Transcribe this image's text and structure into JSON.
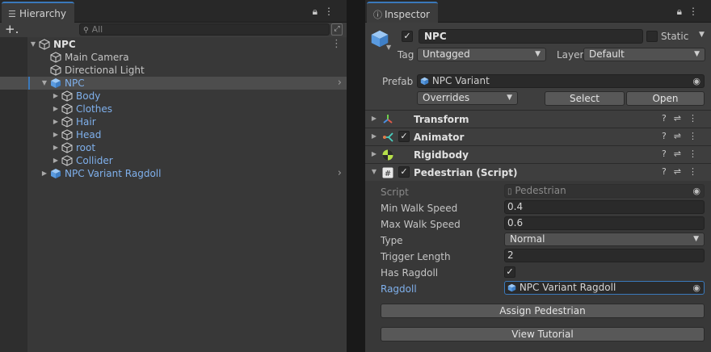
{
  "hierarchy": {
    "tab_label": "Hierarchy",
    "tab_icon": "list-icon",
    "add_label": "+.",
    "search_placeholder": "All",
    "rows": [
      {
        "label": "NPC",
        "kind": "scene",
        "depth": 0,
        "expanded": true,
        "prefab": false,
        "selected": false
      },
      {
        "label": "Main Camera",
        "kind": "object",
        "depth": 1,
        "prefab": false,
        "selected": false
      },
      {
        "label": "Directional Light",
        "kind": "object",
        "depth": 1,
        "prefab": false,
        "selected": false
      },
      {
        "label": "NPC",
        "kind": "prefab-root",
        "depth": 1,
        "expanded": true,
        "prefab": true,
        "selected": true
      },
      {
        "label": "Body",
        "kind": "object",
        "depth": 2,
        "collapsed": true,
        "prefab": true,
        "selected": false
      },
      {
        "label": "Clothes",
        "kind": "object",
        "depth": 2,
        "collapsed": true,
        "prefab": true,
        "selected": false
      },
      {
        "label": "Hair",
        "kind": "object",
        "depth": 2,
        "collapsed": true,
        "prefab": true,
        "selected": false
      },
      {
        "label": "Head",
        "kind": "object",
        "depth": 2,
        "collapsed": true,
        "prefab": true,
        "selected": false
      },
      {
        "label": "root",
        "kind": "object",
        "depth": 2,
        "collapsed": true,
        "prefab": true,
        "selected": false
      },
      {
        "label": "Collider",
        "kind": "object",
        "depth": 2,
        "collapsed": true,
        "prefab": true,
        "selected": false
      },
      {
        "label": "NPC Variant Ragdoll",
        "kind": "prefab-root",
        "depth": 1,
        "collapsed": true,
        "prefab": true,
        "selected": false
      }
    ]
  },
  "inspector": {
    "tab_label": "Inspector",
    "tab_icon": "info-icon",
    "object_name": "NPC",
    "active": true,
    "static_label": "Static",
    "tag_label": "Tag",
    "tag_value": "Untagged",
    "layer_label": "Layer",
    "layer_value": "Default",
    "prefab_label": "Prefab",
    "prefab_value": "NPC Variant",
    "overrides_label": "Overrides",
    "select_label": "Select",
    "open_label": "Open",
    "components": [
      {
        "name": "Transform",
        "icon": "transform-icon",
        "has_toggle": false
      },
      {
        "name": "Animator",
        "icon": "animator-icon",
        "has_toggle": true
      },
      {
        "name": "Rigidbody",
        "icon": "rigidbody-icon",
        "has_toggle": false
      },
      {
        "name": "Pedestrian (Script)",
        "icon": "script-icon",
        "has_toggle": true,
        "expanded": true
      }
    ],
    "script": {
      "script_label": "Script",
      "script_value": "Pedestrian",
      "min_walk_label": "Min Walk Speed",
      "min_walk_value": "0.4",
      "max_walk_label": "Max Walk Speed",
      "max_walk_value": "0.6",
      "type_label": "Type",
      "type_value": "Normal",
      "trigger_label": "Trigger Length",
      "trigger_value": "2",
      "ragdoll_flag_label": "Has Ragdoll",
      "ragdoll_flag_value": true,
      "ragdoll_label": "Ragdoll",
      "ragdoll_value": "NPC Variant Ragdoll",
      "assign_button": "Assign Pedestrian",
      "tutorial_button": "View Tutorial"
    }
  },
  "colors": {
    "accent": "#3a79bb",
    "prefab_blue": "#7fb0ec",
    "panel_bg": "#383838"
  }
}
